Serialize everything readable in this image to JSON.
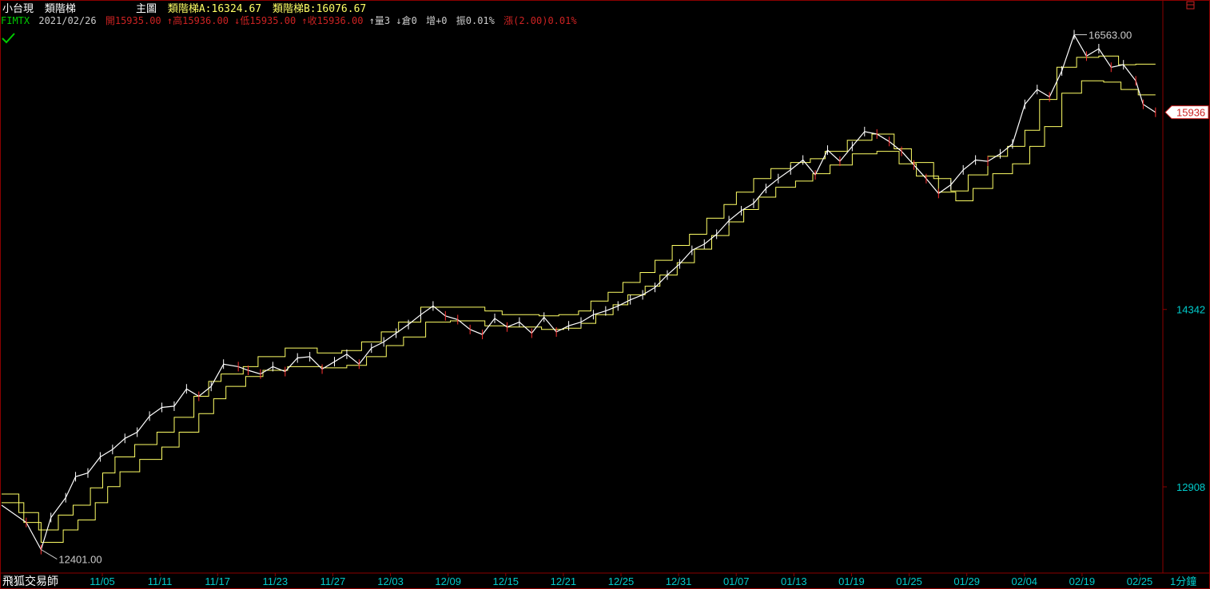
{
  "header": {
    "instrument_name": "小台現",
    "indicator_name": "類階梯",
    "panel_label": "主圖",
    "ladder_a_label": "類階梯A:16324.67",
    "ladder_b_label": "類階梯B:16076.67",
    "symbol": "FIMTX",
    "date": "2021/02/26",
    "open_text": "開15935.00",
    "high_text": "↑高15936.00",
    "low_text": "↓低15935.00",
    "close_text": "↑收15936.00",
    "volume_text": "↑量3",
    "oi_text": "↓倉0",
    "oi_change_text": "增+0",
    "amplitude_text": "振0.01%",
    "change_text": "漲(2.00)0.01%"
  },
  "footer": {
    "brand": "飛狐交易師",
    "interval": "1分鐘"
  },
  "colors": {
    "background": "#000000",
    "ladder": "#ffff66",
    "price": "#ffffff",
    "down_tick": "#ff3333",
    "axis_text": "#00cccc",
    "header_red": "#cc2222",
    "header_yellow": "#ffff66",
    "frame": "#8b0000"
  },
  "chart_data": {
    "type": "line",
    "x_labels": [
      "11/05",
      "11/11",
      "11/17",
      "11/23",
      "11/27",
      "12/03",
      "12/09",
      "12/15",
      "12/21",
      "12/25",
      "12/31",
      "01/07",
      "01/13",
      "01/19",
      "01/25",
      "01/29",
      "02/04",
      "02/19",
      "02/25"
    ],
    "y_ticks": [
      12908,
      14342
    ],
    "ylim": [
      12250,
      16650
    ],
    "grid": false,
    "last_price_label": "15936",
    "max_label": "16563.00",
    "min_label": "12401.00",
    "max_value": 16563,
    "min_value": 12401,
    "last_value": 15936,
    "price_points": [
      [
        0,
        12760
      ],
      [
        1,
        12620
      ],
      [
        1.6,
        12401
      ],
      [
        2,
        12660
      ],
      [
        2.6,
        12820
      ],
      [
        3,
        12990
      ],
      [
        3.5,
        13020
      ],
      [
        4,
        13150
      ],
      [
        4.5,
        13210
      ],
      [
        5,
        13300
      ],
      [
        5.5,
        13350
      ],
      [
        6,
        13480
      ],
      [
        6.5,
        13550
      ],
      [
        7,
        13560
      ],
      [
        7.5,
        13700
      ],
      [
        8,
        13640
      ],
      [
        8.5,
        13720
      ],
      [
        9,
        13900
      ],
      [
        9.6,
        13880
      ],
      [
        10,
        13850
      ],
      [
        10.5,
        13820
      ],
      [
        11,
        13880
      ],
      [
        11.5,
        13840
      ],
      [
        12,
        13950
      ],
      [
        12.5,
        13960
      ],
      [
        13,
        13860
      ],
      [
        13.5,
        13920
      ],
      [
        14,
        13980
      ],
      [
        14.5,
        13900
      ],
      [
        15,
        14030
      ],
      [
        15.5,
        14080
      ],
      [
        16,
        14150
      ],
      [
        16.5,
        14220
      ],
      [
        17,
        14300
      ],
      [
        17.5,
        14370
      ],
      [
        18,
        14290
      ],
      [
        18.5,
        14260
      ],
      [
        19,
        14180
      ],
      [
        19.5,
        14140
      ],
      [
        20,
        14270
      ],
      [
        20.5,
        14200
      ],
      [
        21,
        14240
      ],
      [
        21.5,
        14150
      ],
      [
        22,
        14280
      ],
      [
        22.5,
        14160
      ],
      [
        23,
        14210
      ],
      [
        23.5,
        14240
      ],
      [
        24,
        14300
      ],
      [
        24.5,
        14330
      ],
      [
        25,
        14370
      ],
      [
        25.5,
        14420
      ],
      [
        26,
        14460
      ],
      [
        26.5,
        14520
      ],
      [
        27,
        14620
      ],
      [
        27.5,
        14710
      ],
      [
        28,
        14820
      ],
      [
        28.5,
        14870
      ],
      [
        29,
        14950
      ],
      [
        29.5,
        15060
      ],
      [
        30,
        15140
      ],
      [
        30.5,
        15200
      ],
      [
        31,
        15320
      ],
      [
        31.5,
        15400
      ],
      [
        32,
        15470
      ],
      [
        32.5,
        15550
      ],
      [
        33,
        15430
      ],
      [
        33.5,
        15630
      ],
      [
        34,
        15540
      ],
      [
        34.5,
        15660
      ],
      [
        35,
        15780
      ],
      [
        35.5,
        15760
      ],
      [
        36,
        15700
      ],
      [
        36.5,
        15620
      ],
      [
        37,
        15510
      ],
      [
        37.5,
        15400
      ],
      [
        38,
        15280
      ],
      [
        38.5,
        15350
      ],
      [
        39,
        15470
      ],
      [
        39.5,
        15550
      ],
      [
        40,
        15540
      ],
      [
        40.5,
        15600
      ],
      [
        41,
        15680
      ],
      [
        41.5,
        16000
      ],
      [
        42,
        16120
      ],
      [
        42.5,
        16060
      ],
      [
        43,
        16270
      ],
      [
        43.5,
        16563
      ],
      [
        44,
        16390
      ],
      [
        44.5,
        16450
      ],
      [
        45,
        16300
      ],
      [
        45.5,
        16320
      ],
      [
        46,
        16190
      ],
      [
        46.3,
        16000
      ],
      [
        46.8,
        15936
      ]
    ],
    "series": [
      {
        "name": "類階梯A",
        "steps": [
          [
            0,
            12850
          ],
          [
            0.7,
            12700
          ],
          [
            1.5,
            12560
          ],
          [
            2.3,
            12680
          ],
          [
            2.9,
            12760
          ],
          [
            3.6,
            12900
          ],
          [
            4.1,
            13020
          ],
          [
            4.6,
            13150
          ],
          [
            5.4,
            13250
          ],
          [
            6.3,
            13350
          ],
          [
            7.0,
            13470
          ],
          [
            7.8,
            13640
          ],
          [
            8.4,
            13760
          ],
          [
            8.9,
            13820
          ],
          [
            9.8,
            13880
          ],
          [
            10.4,
            13960
          ],
          [
            11.5,
            14030
          ],
          [
            12.8,
            13990
          ],
          [
            13.8,
            14010
          ],
          [
            14.6,
            14080
          ],
          [
            15.4,
            14160
          ],
          [
            16.1,
            14240
          ],
          [
            17.0,
            14360
          ],
          [
            18.0,
            14360
          ],
          [
            19.6,
            14330
          ],
          [
            20.3,
            14300
          ],
          [
            21.8,
            14290
          ],
          [
            22.6,
            14300
          ],
          [
            23.4,
            14330
          ],
          [
            23.9,
            14410
          ],
          [
            24.6,
            14480
          ],
          [
            25.2,
            14560
          ],
          [
            25.9,
            14640
          ],
          [
            26.5,
            14740
          ],
          [
            27.2,
            14860
          ],
          [
            27.9,
            14950
          ],
          [
            28.6,
            15080
          ],
          [
            29.3,
            15190
          ],
          [
            29.8,
            15290
          ],
          [
            30.5,
            15400
          ],
          [
            31.2,
            15480
          ],
          [
            32.0,
            15530
          ],
          [
            32.8,
            15560
          ],
          [
            33.4,
            15620
          ],
          [
            34.3,
            15710
          ],
          [
            35.3,
            15760
          ],
          [
            36.2,
            15640
          ],
          [
            36.9,
            15530
          ],
          [
            37.8,
            15400
          ],
          [
            38.5,
            15300
          ],
          [
            39.2,
            15430
          ],
          [
            40.0,
            15580
          ],
          [
            40.8,
            15660
          ],
          [
            41.5,
            15790
          ],
          [
            42.1,
            16040
          ],
          [
            42.8,
            16300
          ],
          [
            43.6,
            16380
          ],
          [
            44.5,
            16390
          ],
          [
            45.3,
            16320
          ],
          [
            46.0,
            16324.67
          ],
          [
            46.8,
            16324.67
          ]
        ]
      },
      {
        "name": "類階梯B",
        "steps": [
          [
            0,
            12780
          ],
          [
            0.9,
            12620
          ],
          [
            1.6,
            12460
          ],
          [
            2.5,
            12560
          ],
          [
            3.1,
            12640
          ],
          [
            3.8,
            12780
          ],
          [
            4.3,
            12910
          ],
          [
            4.8,
            13030
          ],
          [
            5.6,
            13130
          ],
          [
            6.5,
            13230
          ],
          [
            7.2,
            13350
          ],
          [
            8.0,
            13500
          ],
          [
            8.6,
            13620
          ],
          [
            9.1,
            13720
          ],
          [
            9.9,
            13800
          ],
          [
            10.6,
            13850
          ],
          [
            11.6,
            13880
          ],
          [
            13.0,
            13870
          ],
          [
            14.0,
            13890
          ],
          [
            14.8,
            13960
          ],
          [
            15.6,
            14050
          ],
          [
            16.3,
            14120
          ],
          [
            17.2,
            14240
          ],
          [
            18.2,
            14250
          ],
          [
            19.6,
            14210
          ],
          [
            20.5,
            14200
          ],
          [
            21.9,
            14180
          ],
          [
            22.8,
            14190
          ],
          [
            23.5,
            14230
          ],
          [
            24.1,
            14300
          ],
          [
            24.8,
            14380
          ],
          [
            25.4,
            14460
          ],
          [
            26.1,
            14530
          ],
          [
            26.7,
            14620
          ],
          [
            27.4,
            14720
          ],
          [
            28.1,
            14830
          ],
          [
            28.8,
            14940
          ],
          [
            29.5,
            15050
          ],
          [
            30.1,
            15150
          ],
          [
            30.7,
            15250
          ],
          [
            31.4,
            15330
          ],
          [
            32.2,
            15380
          ],
          [
            32.9,
            15440
          ],
          [
            33.6,
            15510
          ],
          [
            34.5,
            15600
          ],
          [
            35.5,
            15620
          ],
          [
            36.4,
            15520
          ],
          [
            37.1,
            15420
          ],
          [
            38.0,
            15290
          ],
          [
            38.7,
            15220
          ],
          [
            39.4,
            15320
          ],
          [
            40.2,
            15440
          ],
          [
            41.0,
            15520
          ],
          [
            41.7,
            15660
          ],
          [
            42.3,
            15820
          ],
          [
            43.0,
            16090
          ],
          [
            43.8,
            16190
          ],
          [
            44.7,
            16180
          ],
          [
            45.4,
            16120
          ],
          [
            46.1,
            16076.67
          ],
          [
            46.8,
            16076.67
          ]
        ]
      }
    ]
  }
}
